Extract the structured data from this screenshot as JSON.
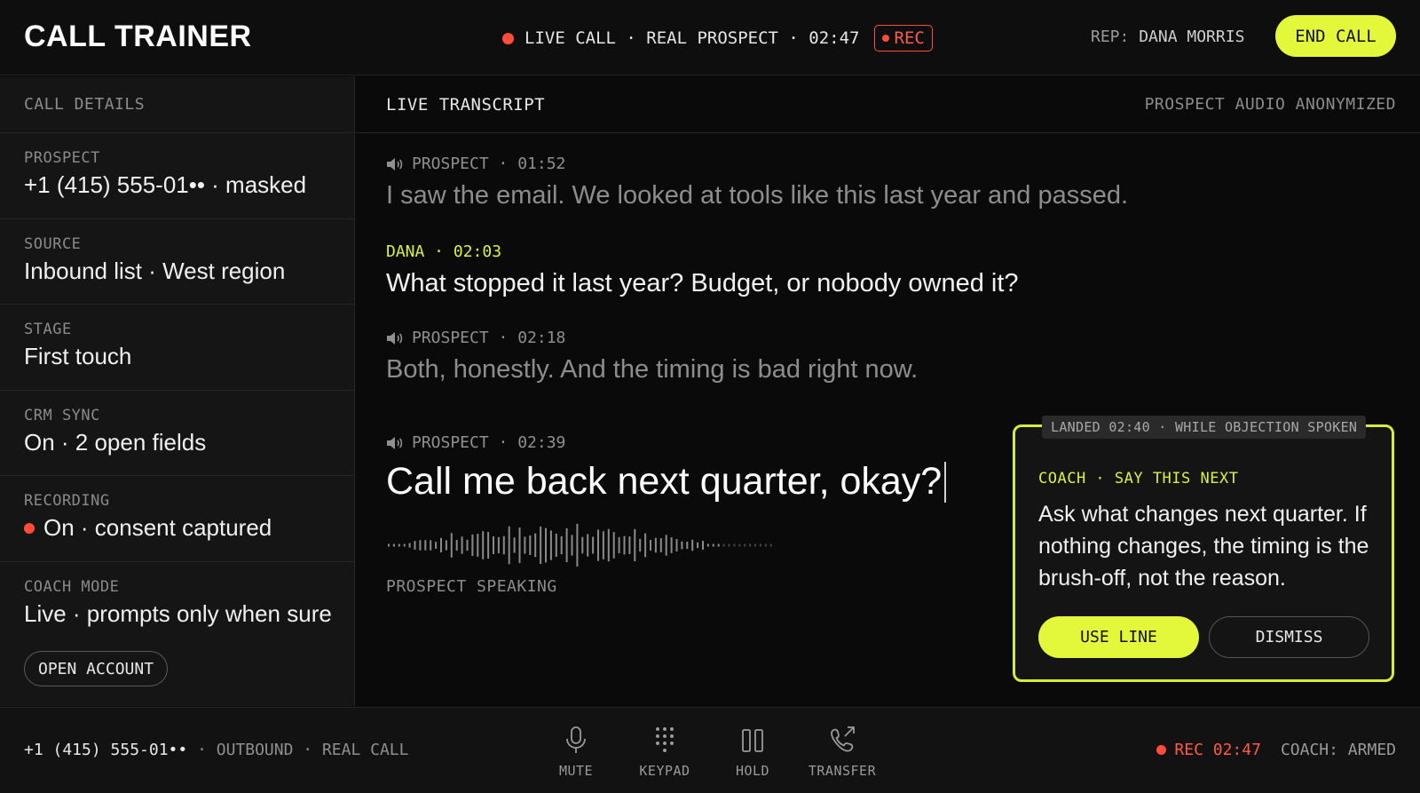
{
  "header": {
    "app_title": "CALL TRAINER",
    "status_text": "LIVE CALL · REAL PROSPECT · 02:47",
    "rec_label": "REC",
    "rep_prefix": "REP:",
    "rep_name": "DANA MORRIS",
    "end_call_label": "END CALL"
  },
  "call_details": {
    "heading": "CALL DETAILS",
    "items": [
      {
        "label": "PROSPECT",
        "value": "+1 (415) 555-01•• · masked"
      },
      {
        "label": "SOURCE",
        "value": "Inbound list · West region"
      },
      {
        "label": "STAGE",
        "value": "First touch"
      },
      {
        "label": "CRM SYNC",
        "value": "On · 2 open fields"
      },
      {
        "label": "RECORDING",
        "value": "On · consent captured"
      },
      {
        "label": "COACH MODE",
        "value": "Live · prompts only when sure"
      }
    ],
    "open_account_label": "OPEN ACCOUNT"
  },
  "transcript": {
    "heading": "LIVE TRANSCRIPT",
    "anonymized_note": "PROSPECT AUDIO ANONYMIZED",
    "messages": [
      {
        "speaker": "PROSPECT",
        "time": "01:52",
        "meta": "PROSPECT · 01:52",
        "text": "I saw the email. We looked at tools like this last year and passed."
      },
      {
        "speaker": "DANA",
        "time": "02:03",
        "meta": "DANA · 02:03",
        "text": "What stopped it last year? Budget, or nobody owned it?"
      },
      {
        "speaker": "PROSPECT",
        "time": "02:18",
        "meta": "PROSPECT · 02:18",
        "text": "Both, honestly. And the timing is bad right now."
      },
      {
        "speaker": "PROSPECT",
        "time": "02:39",
        "meta": "PROSPECT · 02:39",
        "text": "Call me back next quarter, okay?"
      }
    ],
    "speaking_label": "PROSPECT SPEAKING"
  },
  "coach_card": {
    "landed": "LANDED 02:40 · WHILE OBJECTION SPOKEN",
    "label": "COACH · SAY THIS NEXT",
    "text": "Ask what changes next quarter. If nothing changes, the timing is the brush-off, not the reason.",
    "use_label": "USE LINE",
    "dismiss_label": "DISMISS"
  },
  "footer": {
    "number": "+1 (415) 555-01••",
    "call_info": " · OUTBOUND · REAL CALL",
    "controls": [
      {
        "icon": "microphone-icon",
        "label": "MUTE"
      },
      {
        "icon": "keypad-icon",
        "label": "KEYPAD"
      },
      {
        "icon": "pause-icon",
        "label": "HOLD"
      },
      {
        "icon": "transfer-icon",
        "label": "TRANSFER"
      }
    ],
    "rec_timer": "REC 02:47",
    "coach_state": "COACH: ARMED"
  },
  "colors": {
    "accent": "#e3f83a",
    "rec_red": "#ff4d3a",
    "background": "#0b0b0b",
    "panel": "#151515"
  }
}
